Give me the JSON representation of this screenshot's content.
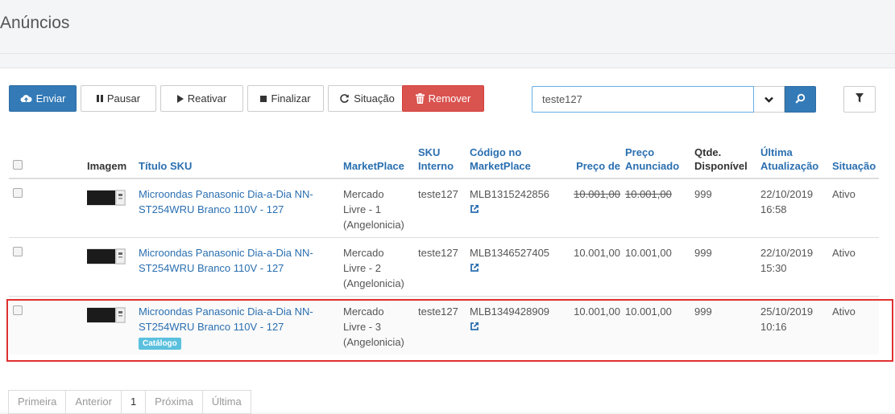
{
  "page": {
    "title": "Anúncios"
  },
  "toolbar": {
    "enviar": "Enviar",
    "pausar": "Pausar",
    "reativar": "Reativar",
    "finalizar": "Finalizar",
    "situacao": "Situação",
    "remover": "Remover"
  },
  "search": {
    "value": "teste127"
  },
  "table": {
    "headers": {
      "imagem": "Imagem",
      "titulo": "Título SKU",
      "marketplace": "MarketPlace",
      "sku_interno_1": "SKU",
      "sku_interno_2": "Interno",
      "codigo_1": "Código no",
      "codigo_2": "MarketPlace",
      "preco_de": "Preço de",
      "preco_anunciado_1": "Preço",
      "preco_anunciado_2": "Anunciado",
      "qtde_1": "Qtde.",
      "qtde_2": "Disponível",
      "ultima_1": "Última",
      "ultima_2": "Atualização",
      "situacao": "Situação"
    },
    "rows": [
      {
        "title_1": "Microondas Panasonic Dia-a-Dia NN-",
        "title_2": "ST254WRU Branco 110V - 127",
        "mp_1": "Mercado",
        "mp_2": "Livre - 1",
        "mp_3": "(Angelonicia)",
        "sku": "teste127",
        "codigo": "MLB1315242856",
        "preco_de": "10.001,00",
        "preco_anunciado": "10.001,00",
        "qtde": "999",
        "data": "22/10/2019",
        "hora": "16:58",
        "situacao": "Ativo"
      },
      {
        "title_1": "Microondas Panasonic Dia-a-Dia NN-",
        "title_2": "ST254WRU Branco 110V - 127",
        "mp_1": "Mercado",
        "mp_2": "Livre - 2",
        "mp_3": "(Angelonicia)",
        "sku": "teste127",
        "codigo": "MLB1346527405",
        "preco_de": "10.001,00",
        "preco_anunciado": "10.001,00",
        "qtde": "999",
        "data": "22/10/2019",
        "hora": "15:30",
        "situacao": "Ativo"
      },
      {
        "title_1": "Microondas Panasonic Dia-a-Dia NN-",
        "title_2": "ST254WRU Branco 110V - 127",
        "badge": "Catálogo",
        "mp_1": "Mercado",
        "mp_2": "Livre - 3",
        "mp_3": "(Angelonicia)",
        "sku": "teste127",
        "codigo": "MLB1349428909",
        "preco_de": "10.001,00",
        "preco_anunciado": "10.001,00",
        "qtde": "999",
        "data": "25/10/2019",
        "hora": "10:16",
        "situacao": "Ativo"
      }
    ]
  },
  "pagination": {
    "primeira": "Primeira",
    "anterior": "Anterior",
    "current": "1",
    "proxima": "Próxima",
    "ultima": "Última"
  },
  "colors": {
    "primary": "#337ab7",
    "danger": "#d9534f",
    "link": "#2a6fb0",
    "badge": "#5bc0de",
    "highlight": "#e03030"
  },
  "icons": {
    "enviar": "cloud-upload-icon",
    "pausar": "pause-icon",
    "reativar": "play-icon",
    "finalizar": "stop-icon",
    "situacao": "refresh-icon",
    "remover": "trash-icon",
    "dropdown": "chevron-down-icon",
    "search": "search-icon",
    "filter": "filter-icon",
    "external": "external-link-icon"
  }
}
